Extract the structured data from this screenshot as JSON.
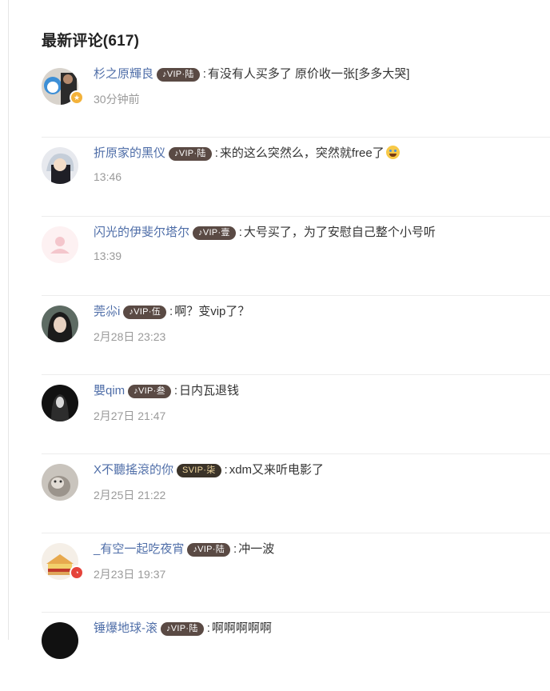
{
  "section": {
    "title": "最新评论(617)"
  },
  "comments": [
    {
      "username": "杉之原輝良",
      "vip": "♪VIP·陆",
      "separator": ":",
      "content": "有没有人买多了 原价收一张[多多大哭]",
      "time": "30分钟前"
    },
    {
      "username": "折原家的黑仪",
      "vip": "♪VIP·陆",
      "separator": ":",
      "content": "来的这么突然么，突然就free了",
      "time": "13:46"
    },
    {
      "username": "闪光的伊斐尔塔尔",
      "vip": "♪VIP·壹",
      "separator": ":",
      "content": "大号买了，为了安慰自己整个小号听",
      "time": "13:39"
    },
    {
      "username": "莞尛i",
      "vip": "♪VIP·伍",
      "separator": ":",
      "content": "啊？变vip了？",
      "time": "2月28日 23:23"
    },
    {
      "username": "嬰qim",
      "vip": "♪VIP·叁",
      "separator": ":",
      "content": "日内瓦退钱",
      "time": "2月27日 21:47"
    },
    {
      "username": "X不聽搖滾的你",
      "vip": "SVIP·柒",
      "separator": ":",
      "content": "xdm又来听电影了",
      "time": "2月25日 21:22"
    },
    {
      "username": "_有空一起吃夜宵",
      "vip": "♪VIP·陆",
      "separator": ":",
      "content": "冲一波",
      "time": "2月23日 19:37"
    },
    {
      "username": "锤爆地球-滚",
      "vip": "♪VIP·陆",
      "separator": ":",
      "content": "啊啊啊啊啊",
      "time": ""
    }
  ],
  "colors": {
    "username": "#4f6ea8",
    "time": "#9a9a9a",
    "divider": "#ececec"
  }
}
